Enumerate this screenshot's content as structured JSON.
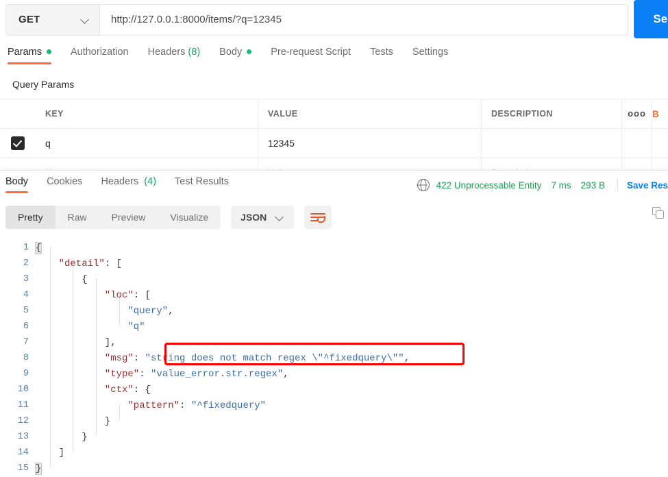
{
  "request": {
    "method": "GET",
    "url": "http://127.0.0.1:8000/items/?q=12345",
    "send_label": "Sen",
    "tabs": [
      {
        "label": "Params",
        "dot": true,
        "active": true
      },
      {
        "label": "Authorization",
        "dot": false,
        "active": false
      },
      {
        "label": "Headers",
        "count": "(8)",
        "dot": false,
        "active": false
      },
      {
        "label": "Body",
        "dot": true,
        "active": false
      },
      {
        "label": "Pre-request Script",
        "dot": false,
        "active": false
      },
      {
        "label": "Tests",
        "dot": false,
        "active": false
      },
      {
        "label": "Settings",
        "dot": false,
        "active": false
      }
    ]
  },
  "query_params": {
    "section_title": "Query Params",
    "columns": [
      "KEY",
      "VALUE",
      "DESCRIPTION"
    ],
    "options_glyph": "ooo",
    "bulk_edit_label": "B",
    "rows": [
      {
        "checked": true,
        "key": "q",
        "value": "12345",
        "description": ""
      }
    ],
    "placeholder_row": {
      "key": "Key",
      "value": "Value",
      "description": "Description"
    }
  },
  "response": {
    "tabs": [
      {
        "label": "Body",
        "active": true
      },
      {
        "label": "Cookies",
        "active": false
      },
      {
        "label": "Headers",
        "count": "(4)",
        "active": false
      },
      {
        "label": "Test Results",
        "active": false
      }
    ],
    "status": "422 Unprocessable Entity",
    "time": "7 ms",
    "size": "293 B",
    "save_response_label": "Save Res",
    "view_modes": [
      {
        "label": "Pretty",
        "selected": true
      },
      {
        "label": "Raw",
        "selected": false
      },
      {
        "label": "Preview",
        "selected": false
      },
      {
        "label": "Visualize",
        "selected": false
      }
    ],
    "format": "JSON"
  },
  "body_code": {
    "lines": [
      {
        "n": "1",
        "indent": 0,
        "tokens": [
          {
            "t": "{",
            "c": "hl"
          }
        ]
      },
      {
        "n": "2",
        "indent": 1,
        "tokens": [
          {
            "t": "\"detail\"",
            "c": "k"
          },
          {
            "t": ": [",
            "c": "p"
          }
        ]
      },
      {
        "n": "3",
        "indent": 2,
        "tokens": [
          {
            "t": "{",
            "c": "p"
          }
        ]
      },
      {
        "n": "4",
        "indent": 3,
        "tokens": [
          {
            "t": "\"loc\"",
            "c": "k"
          },
          {
            "t": ": [",
            "c": "p"
          }
        ]
      },
      {
        "n": "5",
        "indent": 4,
        "tokens": [
          {
            "t": "\"query\"",
            "c": "s"
          },
          {
            "t": ",",
            "c": "p"
          }
        ]
      },
      {
        "n": "6",
        "indent": 4,
        "tokens": [
          {
            "t": "\"q\"",
            "c": "s"
          }
        ]
      },
      {
        "n": "7",
        "indent": 3,
        "tokens": [
          {
            "t": "],",
            "c": "p"
          }
        ]
      },
      {
        "n": "8",
        "indent": 3,
        "tokens": [
          {
            "t": "\"msg\"",
            "c": "k"
          },
          {
            "t": ": ",
            "c": "p"
          },
          {
            "t": "\"string does not match regex \\\"^fixedquery\\\"\"",
            "c": "s"
          },
          {
            "t": ",",
            "c": "p"
          }
        ]
      },
      {
        "n": "9",
        "indent": 3,
        "tokens": [
          {
            "t": "\"type\"",
            "c": "k"
          },
          {
            "t": ": ",
            "c": "p"
          },
          {
            "t": "\"value_error.str.regex\"",
            "c": "s"
          },
          {
            "t": ",",
            "c": "p"
          }
        ]
      },
      {
        "n": "10",
        "indent": 3,
        "tokens": [
          {
            "t": "\"ctx\"",
            "c": "k"
          },
          {
            "t": ": {",
            "c": "p"
          }
        ]
      },
      {
        "n": "11",
        "indent": 4,
        "tokens": [
          {
            "t": "\"pattern\"",
            "c": "k"
          },
          {
            "t": ": ",
            "c": "p"
          },
          {
            "t": "\"^fixedquery\"",
            "c": "s"
          }
        ]
      },
      {
        "n": "12",
        "indent": 3,
        "tokens": [
          {
            "t": "}",
            "c": "p"
          }
        ]
      },
      {
        "n": "13",
        "indent": 2,
        "tokens": [
          {
            "t": "}",
            "c": "p"
          }
        ]
      },
      {
        "n": "14",
        "indent": 1,
        "tokens": [
          {
            "t": "]",
            "c": "p"
          }
        ]
      },
      {
        "n": "15",
        "indent": 0,
        "tokens": [
          {
            "t": "}",
            "c": "hl"
          }
        ]
      }
    ]
  },
  "annotation": {
    "type": "red-rectangle-highlight",
    "target": "msg string value on line 8"
  }
}
